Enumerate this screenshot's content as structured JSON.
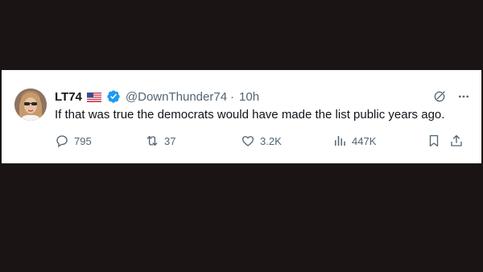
{
  "tweet": {
    "author": {
      "display_name": "LT74",
      "handle": "@DownThunder74",
      "flag_icon": "us-flag-icon",
      "verified_icon": "verified-badge-icon",
      "verified_color": "#1d9bf0"
    },
    "separator": "·",
    "time": "10h",
    "text": "If that was true the democrats would have made the list public years ago.",
    "stats": {
      "replies": "795",
      "reposts": "37",
      "likes": "3.2K",
      "views": "447K"
    },
    "icons": {
      "grok": "grok-icon",
      "more": "more-icon",
      "reply": "reply-icon",
      "repost": "repost-icon",
      "like": "heart-icon",
      "views": "views-icon",
      "bookmark": "bookmark-icon",
      "share": "share-icon"
    },
    "colors": {
      "text": "#0f1419",
      "secondary": "#536471",
      "background": "#ffffff",
      "letterbox": "#1a1514"
    }
  }
}
